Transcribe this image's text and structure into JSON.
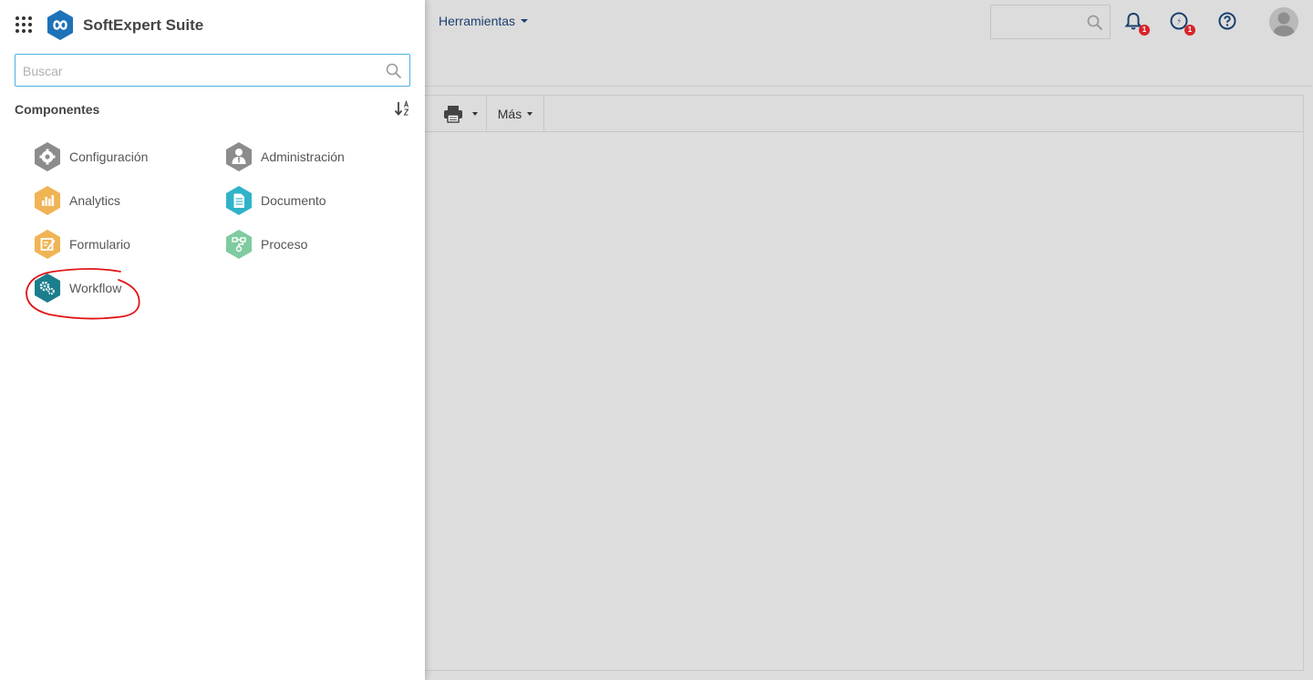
{
  "app": {
    "title": "SoftExpert Suite"
  },
  "topbar": {
    "tools_menu_label": "Herramientas",
    "notifications_badge": "1",
    "tasks_badge": "1"
  },
  "toolbar": {
    "more_label": "Más"
  },
  "drawer": {
    "search_placeholder": "Buscar",
    "section_title": "Componentes",
    "components": [
      {
        "label": "Configuración",
        "icon": "gear-icon",
        "color": "#8c8c8c"
      },
      {
        "label": "Administración",
        "icon": "admin-user-icon",
        "color": "#8c8c8c"
      },
      {
        "label": "Analytics",
        "icon": "bar-chart-icon",
        "color": "#f0b455"
      },
      {
        "label": "Documento",
        "icon": "document-icon",
        "color": "#2fb3c8"
      },
      {
        "label": "Formulario",
        "icon": "form-edit-icon",
        "color": "#f0b455"
      },
      {
        "label": "Proceso",
        "icon": "process-flow-icon",
        "color": "#7fcba0"
      },
      {
        "label": "Workflow",
        "icon": "workflow-gears-icon",
        "color": "#1b7e8c"
      }
    ]
  },
  "colors": {
    "accent_blue": "#1d72b8",
    "focus_border": "#4ab3e3",
    "annotation_red": "#e01414",
    "badge_red": "#d8232a"
  }
}
